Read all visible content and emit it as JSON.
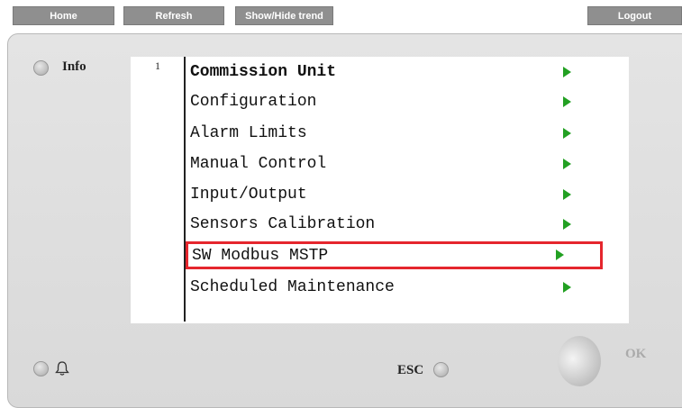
{
  "toolbar": {
    "home": "Home",
    "refresh": "Refresh",
    "trend": "Show/Hide trend",
    "logout": "Logout"
  },
  "panel": {
    "info_label": "Info",
    "esc_label": "ESC",
    "ok_label": "OK",
    "page_number": "1"
  },
  "menu": [
    {
      "label": "Commission Unit",
      "bold": true
    },
    {
      "label": "Configuration"
    },
    {
      "label": "Alarm Limits"
    },
    {
      "label": "Manual Control"
    },
    {
      "label": "Input/Output"
    },
    {
      "label": "Sensors Calibration"
    },
    {
      "label": "SW Modbus MSTP",
      "highlighted": true
    },
    {
      "label": "Scheduled Maintenance"
    }
  ],
  "icons": {
    "menu_arrow": "right-triangle-green",
    "alarm": "bell-icon"
  },
  "colors": {
    "arrow": "#22a022",
    "highlight": "#e5262d",
    "toolbar": "#8f8f8f"
  }
}
